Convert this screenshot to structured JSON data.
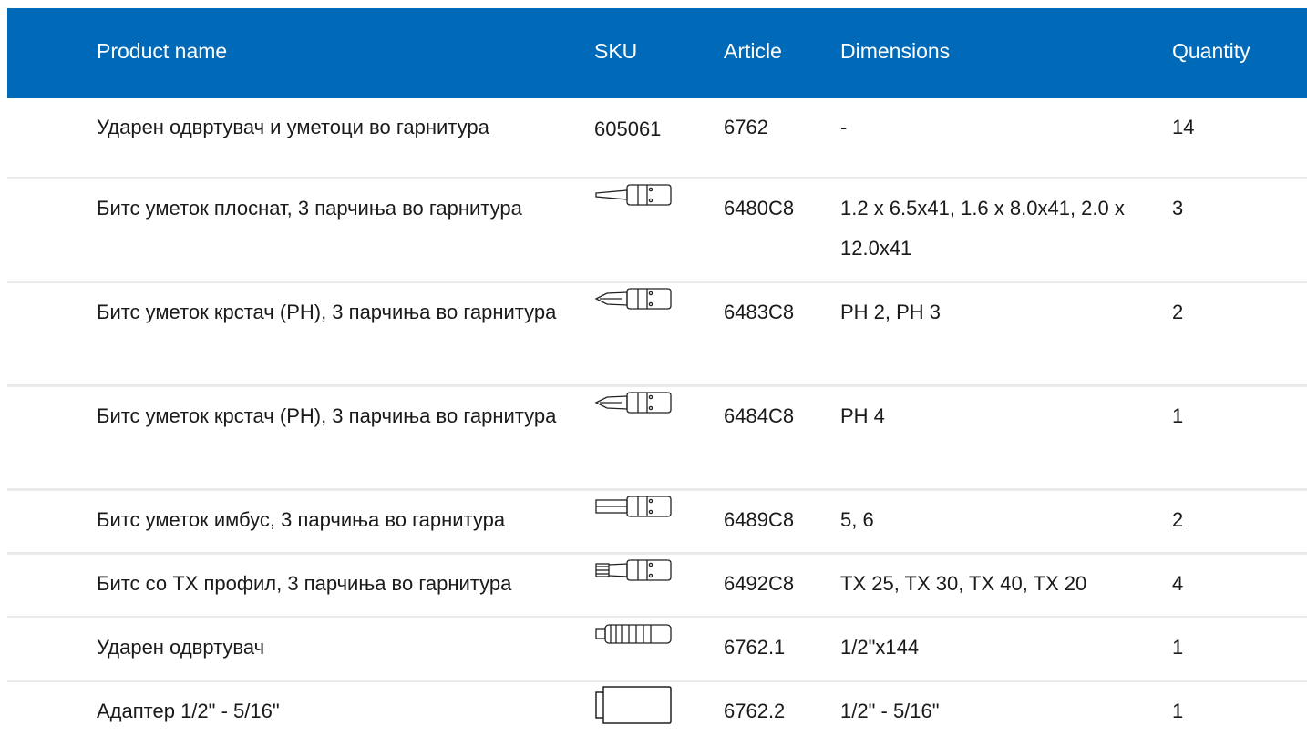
{
  "header": {
    "product_name": "Product name",
    "sku": "SKU",
    "article": "Article",
    "dimensions": "Dimensions",
    "quantity": "Quantity"
  },
  "colors": {
    "header_bg": "#0069b8",
    "header_text": "#ffffff",
    "row_divider": "#eaeaea"
  },
  "rows": [
    {
      "name": "Ударен одвртувач и уметоци во гарнитура",
      "sku": "605061",
      "article": "6762",
      "dimensions": "-",
      "quantity": "14",
      "icon": "none"
    },
    {
      "name": "Битс уметок плоснат, 3 парчиња во гарнитура",
      "sku": "",
      "article": "6480C8",
      "dimensions": "1.2 x 6.5x41, 1.6 x 8.0x41, 2.0 x 12.0x41",
      "quantity": "3",
      "icon": "flat-bit-icon"
    },
    {
      "name": "Битс уметок крстач (PH), 3 парчиња во гарнитура",
      "sku": "",
      "article": "6483C8",
      "dimensions": "PH 2, PH 3",
      "quantity": "2",
      "icon": "phillips-bit-icon"
    },
    {
      "name": "Битс уметок крстач (PH), 3 парчиња во гарнитура",
      "sku": "",
      "article": "6484C8",
      "dimensions": "PH 4",
      "quantity": "1",
      "icon": "phillips-bit-icon"
    },
    {
      "name": "Битс уметок имбус, 3 парчиња во гарнитура",
      "sku": "",
      "article": "6489C8",
      "dimensions": "5, 6",
      "quantity": "2",
      "icon": "hex-bit-icon"
    },
    {
      "name": "Битс со TX профил, 3 парчиња во гарнитура",
      "sku": "",
      "article": "6492C8",
      "dimensions": "TX 25, TX 30, TX 40, TX 20",
      "quantity": "4",
      "icon": "torx-bit-icon"
    },
    {
      "name": "Ударен одвртувач",
      "sku": "",
      "article": "6762.1",
      "dimensions": "1/2\"x144",
      "quantity": "1",
      "icon": "impact-driver-icon"
    },
    {
      "name": "Адаптер 1/2\" - 5/16\"",
      "sku": "",
      "article": "6762.2",
      "dimensions": "1/2\" - 5/16\"",
      "quantity": "1",
      "icon": "adapter-icon"
    }
  ]
}
